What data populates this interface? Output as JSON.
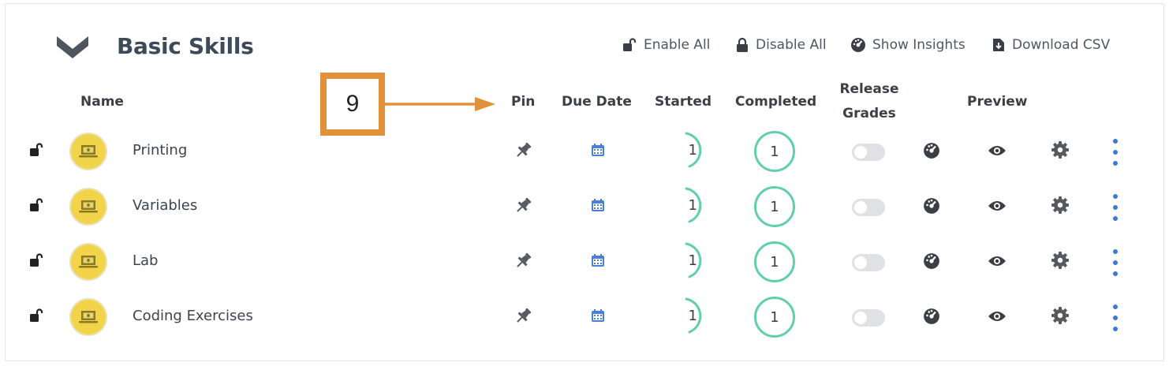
{
  "section": {
    "title": "Basic Skills",
    "actions": {
      "enable_all": "Enable All",
      "disable_all": "Disable All",
      "show_insights": "Show Insights",
      "download_csv": "Download CSV"
    }
  },
  "columns": {
    "name": "Name",
    "pin": "Pin",
    "due_date": "Due Date",
    "started": "Started",
    "completed": "Completed",
    "release_grades_line1": "Release",
    "release_grades_line2": "Grades",
    "preview": "Preview"
  },
  "annotation": {
    "label": "9"
  },
  "rows": [
    {
      "name": "Printing",
      "started": "1",
      "completed": "1",
      "release_grades": false
    },
    {
      "name": "Variables",
      "started": "1",
      "completed": "1",
      "release_grades": false
    },
    {
      "name": "Lab",
      "started": "1",
      "completed": "1",
      "release_grades": false
    },
    {
      "name": "Coding Exercises",
      "started": "1",
      "completed": "1",
      "release_grades": false
    }
  ],
  "colors": {
    "accent_green": "#5fd0a7",
    "accent_blue": "#3b79d8",
    "annotation_orange": "#e0913a",
    "avatar_yellow": "#f2d44a"
  },
  "icons": {
    "collapse": "chevron-down-icon",
    "enable_all": "unlock-icon",
    "disable_all": "lock-icon",
    "show_insights": "gauge-icon",
    "download_csv": "download-file-icon",
    "row_lock": "unlock-icon",
    "avatar": "laptop-icon",
    "pin": "pin-icon",
    "due_date": "calendar-icon",
    "insights": "gauge-icon",
    "preview": "eye-icon",
    "settings": "gear-icon",
    "more": "more-vertical-icon"
  }
}
